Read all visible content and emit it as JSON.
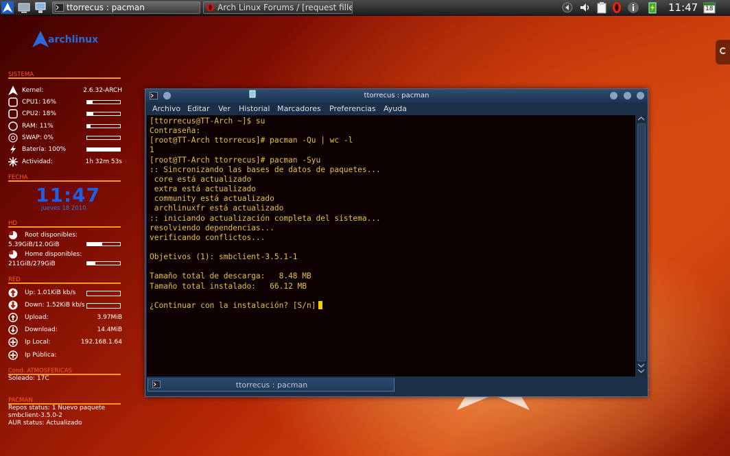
{
  "taskbar": {
    "tasks": [
      {
        "label": "ttorrecus : pacman"
      },
      {
        "label": "Arch Linux Forums / [request filled] Co"
      }
    ],
    "clock": "11:47",
    "calendar_day": "18"
  },
  "desktop": {
    "logo_text": "archlinux",
    "watermark_text": "archlinux"
  },
  "sidebar": {
    "sistema": {
      "title": "SISTEMA",
      "kernel_label": "Kernel:",
      "kernel_value": "2.6.32-ARCH",
      "cpu1": "CPU1: 16%",
      "cpu1_level": 0.16,
      "cpu2": "CPU2: 18%",
      "cpu2_level": 0.18,
      "ram": "RAM: 11%",
      "ram_level": 0.11,
      "swap": "SWAP: 0%",
      "swap_level": 0.0,
      "bateria": "Batería: 100%",
      "bateria_level": 1.0,
      "actividad_label": "Actividad:",
      "actividad_value": "1h 32m 53s"
    },
    "fecha": {
      "title": "FECHA",
      "time": "11:47",
      "date": "jueves 18 2010"
    },
    "hd": {
      "title": "HD",
      "root_label": "Root disponibles:",
      "root_value": "5.39GiB/12.0GiB",
      "root_level": 0.45,
      "home_label": "Home disponibles:",
      "home_value": "211GiB/279GiB",
      "home_level": 0.24
    },
    "red": {
      "title": "RED",
      "up": "Up: 1.01KiB kb/s",
      "down": "Down: 1.52KiB kb/s",
      "upload_label": "Upload:",
      "upload_value": "3.97MiB",
      "download_label": "Download:",
      "download_value": "14.4MiB",
      "iplocal_label": "Ip Local:",
      "iplocal_value": "192.168.1.64",
      "ippublica_label": "Ip Pública:"
    },
    "cond": {
      "title": "Cond. ATMOSFERICAS",
      "value": "Soleado: 17C"
    },
    "pacman": {
      "title": "PACMAN",
      "line1": "Repos status: 1 Nuevo paquete",
      "line2": "smbclient-3.5.0-2",
      "line3": "AUR status: Actualizado"
    }
  },
  "terminal": {
    "title": "ttorrecus : pacman",
    "menu": [
      "Archivo",
      "Editar",
      "Ver",
      "Historial",
      "Marcadores",
      "Preferencias",
      "Ayuda"
    ],
    "lines": [
      "[ttorrecus@TT-Arch ~]$ su",
      "Contraseña:",
      "[root@TT-Arch ttorrecus]# pacman -Qu | wc -l",
      "1",
      "[root@TT-Arch ttorrecus]# pacman -Syu",
      ":: Sincronizando las bases de datos de paquetes...",
      " core está actualizado",
      " extra está actualizado",
      " community está actualizado",
      " archlinuxfr está actualizado",
      ":: iniciando actualización completa del sistema...",
      "resolviendo dependencias...",
      "verificando conflictos...",
      "",
      "Objetivos (1): smbclient-3.5.1-1",
      "",
      "Tamaño total de descarga:   8.48 MB",
      "Tamaño total instalado:   66.12 MB",
      "",
      "¿Continuar con la instalación? [S/n]"
    ],
    "tab_label": "ttorrecus : pacman"
  }
}
